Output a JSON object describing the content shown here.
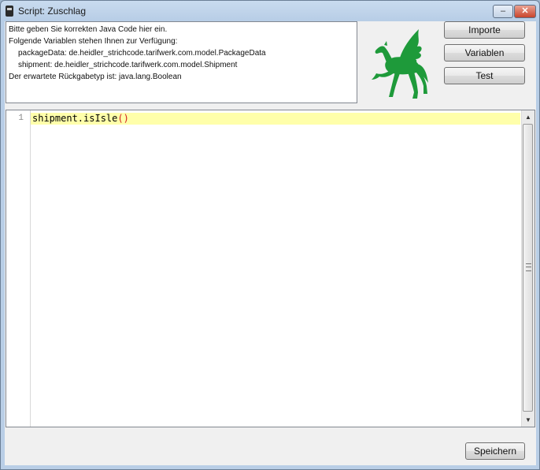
{
  "window": {
    "title": "Script: Zuschlag",
    "minimize_glyph": "–",
    "close_glyph": "✕"
  },
  "info": {
    "lines": [
      "Bitte geben Sie korrekten Java Code hier ein.",
      "Folgende Variablen stehen Ihnen zur Verfügung:",
      "packageData: de.heidler_strichcode.tarifwerk.com.model.PackageData",
      "shipment: de.heidler_strichcode.tarifwerk.com.model.Shipment",
      "Der erwartete Rückgabetyp ist: java.lang.Boolean"
    ]
  },
  "buttons": {
    "imports": "Importe",
    "variables": "Variablen",
    "test": "Test",
    "save": "Speichern"
  },
  "editor": {
    "line_number": "1",
    "code_text": "shipment.isIsle",
    "code_parens": "()"
  },
  "icons": {
    "logo": "pegasus-icon",
    "logo_color": "#1e9a3a"
  }
}
